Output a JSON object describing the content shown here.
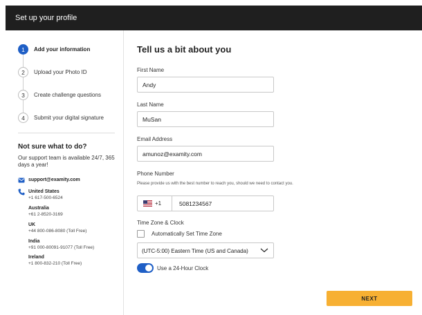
{
  "header": {
    "title": "Set up your profile"
  },
  "sidebar": {
    "steps": [
      {
        "number": "1",
        "label": "Add your information",
        "active": true
      },
      {
        "number": "2",
        "label": "Upload your Photo ID",
        "active": false
      },
      {
        "number": "3",
        "label": "Create challenge questions",
        "active": false
      },
      {
        "number": "4",
        "label": "Submit your digital signature",
        "active": false
      }
    ],
    "help": {
      "title": "Not sure what to do?",
      "text": "Our support team is available 24/7, 365 days a year!",
      "email": "support@examity.com",
      "email_icon": "mail-icon",
      "phone_icon": "phone-icon",
      "contacts": [
        {
          "country": "United States",
          "number": "+1 617-500-6524"
        },
        {
          "country": "Australia",
          "number": "+61 2-8520-3169"
        },
        {
          "country": "UK",
          "number": "+44 800-086-8080 (Toll Free)"
        },
        {
          "country": "India",
          "number": "+91 000-80091-91077 (Toll Free)"
        },
        {
          "country": "Ireland",
          "number": "+1 800-832-210 (Toll Free)"
        }
      ]
    }
  },
  "main": {
    "title": "Tell us a bit about you",
    "first_name": {
      "label": "First Name",
      "value": "Andy"
    },
    "last_name": {
      "label": "Last Name",
      "value": "MuSan"
    },
    "email": {
      "label": "Email Address",
      "value": "amunoz@examity.com"
    },
    "phone": {
      "label": "Phone Number",
      "help": "Please provide us with the best number to reach you, should we need to contact you.",
      "country_code": "+1",
      "flag_icon": "us-flag-icon",
      "value": "5081234567"
    },
    "timezone": {
      "label": "Time Zone & Clock",
      "auto_label": "Automatically Set Time Zone",
      "auto_checked": false,
      "selected": "(UTC-5:00) Eastern Time (US and Canada)",
      "clock_label": "Use a 24-Hour Clock",
      "clock_on": true
    },
    "next_label": "NEXT"
  },
  "colors": {
    "accent": "#1f5fc6",
    "button": "#f7b033",
    "header": "#1f1f1f"
  }
}
